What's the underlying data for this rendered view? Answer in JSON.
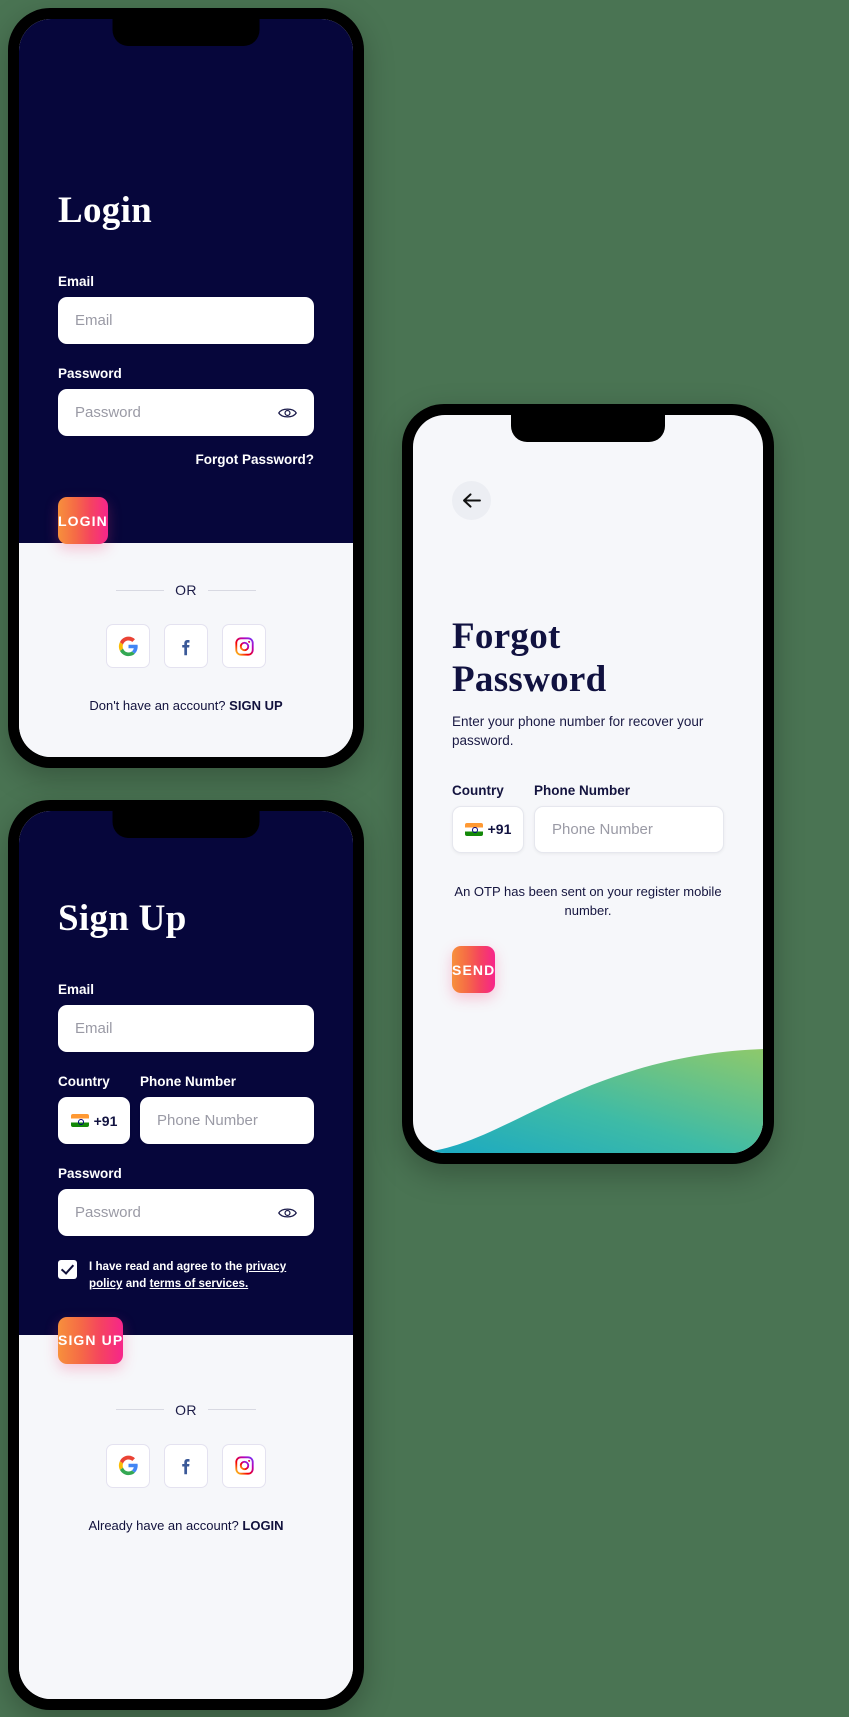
{
  "theme": {
    "page_background": "#4a7453",
    "dark_panel": "#06063b",
    "light_panel": "#f6f7fa",
    "button_gradient_start": "#f7903c",
    "button_gradient_end": "#f7258b",
    "title_dark": "#111240"
  },
  "login": {
    "title": "Login",
    "email_label": "Email",
    "email_placeholder": "Email",
    "password_label": "Password",
    "password_placeholder": "Password",
    "forgot_link": "Forgot Password?",
    "submit_label": "LOGIN",
    "or_label": "OR",
    "social": [
      {
        "name": "google",
        "label": "G"
      },
      {
        "name": "facebook",
        "label": "f"
      },
      {
        "name": "instagram",
        "label": ""
      }
    ],
    "account_prompt": "Don't have an account?",
    "account_action": "SIGN UP"
  },
  "signup": {
    "title": "Sign Up",
    "email_label": "Email",
    "email_placeholder": "Email",
    "country_label": "Country",
    "country_code": "+91",
    "phone_label": "Phone Number",
    "phone_placeholder": "Phone Number",
    "password_label": "Password",
    "password_placeholder": "Password",
    "terms_prefix": "I have read and agree to the ",
    "terms_privacy": "privacy policy",
    "terms_middle": " and ",
    "terms_services": "terms of services.",
    "terms_checked": true,
    "submit_label": "SIGN UP",
    "or_label": "OR",
    "account_prompt": "Already have an account?",
    "account_action": "LOGIN"
  },
  "forgot": {
    "back_icon": "arrow-left",
    "title": "Forgot Password",
    "subtitle": "Enter your phone number for recover your password.",
    "country_label": "Country",
    "country_code": "+91",
    "phone_label": "Phone Number",
    "phone_placeholder": "Phone Number",
    "otp_note": "An OTP has been sent on your register mobile number.",
    "submit_label": "SEND"
  }
}
